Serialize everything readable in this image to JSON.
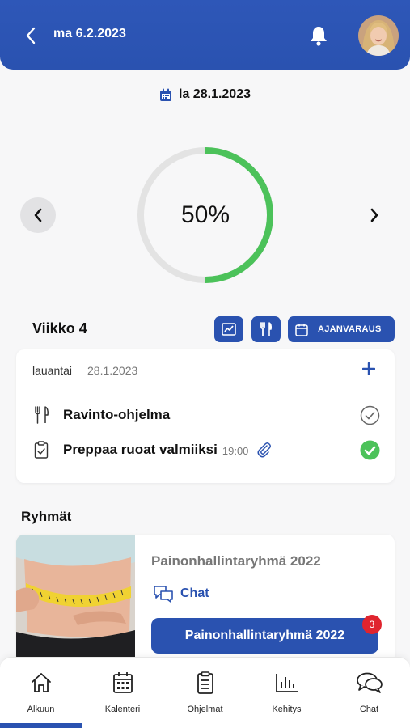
{
  "header": {
    "title": "ma 6.2.2023"
  },
  "selected_date": "la 28.1.2023",
  "progress": {
    "percent_label": "50%",
    "value": 0.5,
    "color": "#4cc25a",
    "track_color": "#e3e3e3"
  },
  "week": {
    "title": "Viikko 4",
    "booking_label": "AJANVARAUS"
  },
  "day_card": {
    "day_name": "lauantai",
    "date": "28.1.2023",
    "tasks": [
      {
        "title": "Ravinto-ohjelma",
        "time": "",
        "done": false
      },
      {
        "title": "Preppaa ruoat valmiiksi",
        "time": "19:00",
        "done": true
      }
    ]
  },
  "groups": {
    "title": "Ryhmät",
    "items": [
      {
        "name": "Painonhallintaryhmä 2022",
        "chat_label": "Chat",
        "button_label": "Painonhallintaryhmä 2022",
        "badge": "3"
      }
    ]
  },
  "bottom_nav": [
    {
      "label": "Alkuun",
      "icon": "home-icon",
      "active": true
    },
    {
      "label": "Kalenteri",
      "icon": "calendar-icon",
      "active": false
    },
    {
      "label": "Ohjelmat",
      "icon": "clipboard-icon",
      "active": false
    },
    {
      "label": "Kehitys",
      "icon": "bar-chart-icon",
      "active": false
    },
    {
      "label": "Chat",
      "icon": "chat-bubbles-icon",
      "active": false
    }
  ],
  "colors": {
    "primary": "#2a52b0",
    "success": "#4cc25a",
    "badge": "#e0242e"
  }
}
